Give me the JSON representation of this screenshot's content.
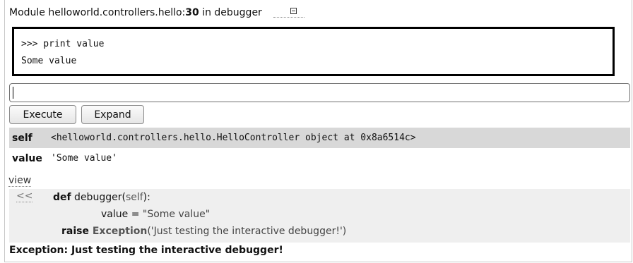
{
  "header": {
    "prefix": "Module helloworld.controllers.hello:",
    "line": "30",
    "suffix": " in debugger"
  },
  "console": {
    "lines": [
      ">>> print value",
      "Some value"
    ]
  },
  "input": {
    "value": ""
  },
  "buttons": {
    "execute": "Execute",
    "expand": "Expand"
  },
  "variables": [
    {
      "name": "self",
      "value": "<helloworld.controllers.hello.HelloController object at 0x8a6514c>"
    },
    {
      "name": "value",
      "value": "'Some value'"
    }
  ],
  "view_link": "view",
  "code": {
    "back_link": "<<",
    "line1": {
      "kw": "def",
      "rest": " debugger(",
      "param": "self",
      "end": "):"
    },
    "line2": {
      "text": "value = ",
      "str": "\"Some value\""
    },
    "line3": {
      "kw": "raise",
      "cls": " Exception",
      "str": "('Just testing the interactive debugger!')"
    }
  },
  "exception": "Exception: Just testing the interactive debugger!"
}
